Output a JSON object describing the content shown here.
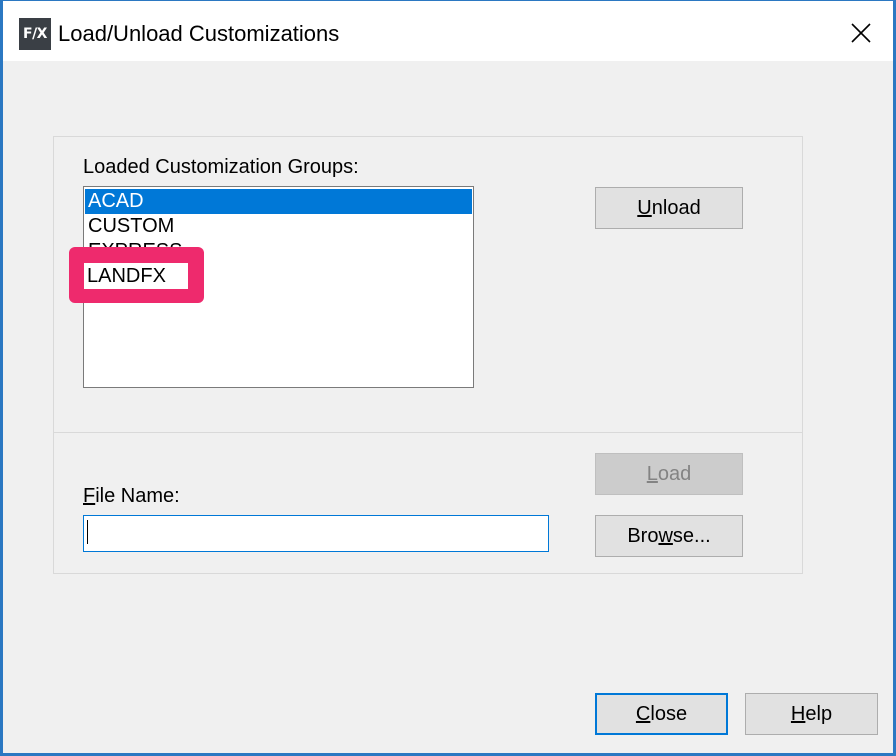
{
  "window": {
    "title": "Load/Unload Customizations",
    "icon_text": "F/X",
    "accent_color": "#0078d7",
    "highlight_color": "#ee2a6d"
  },
  "loaded_groups": {
    "label": "Loaded Customization Groups:",
    "items": [
      "ACAD",
      "CUSTOM",
      "EXPRESS",
      "LANDFX"
    ],
    "selected": "ACAD"
  },
  "buttons": {
    "unload": "Unload",
    "load": "Load",
    "browse": "Browse...",
    "close": "Close",
    "help": "Help"
  },
  "file_name": {
    "label": "File Name:",
    "value": ""
  },
  "icons": {
    "close": "close-icon",
    "app": "landfx-logo-icon"
  }
}
